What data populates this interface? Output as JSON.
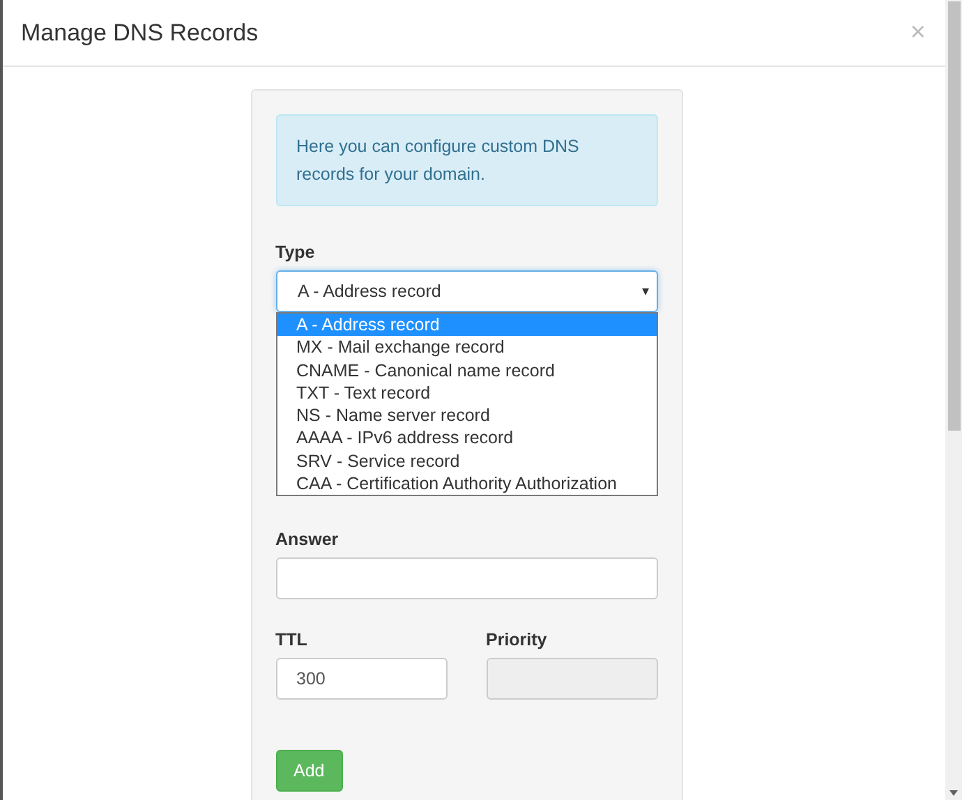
{
  "modal": {
    "title": "Manage DNS Records",
    "close": "×"
  },
  "info": "Here you can configure custom DNS records for your domain.",
  "type_field": {
    "label": "Type",
    "value": "A - Address record",
    "caret": "▾",
    "expanded": true,
    "options": [
      {
        "label": "A - Address record",
        "selected": true
      },
      {
        "label": "MX - Mail exchange record",
        "selected": false
      },
      {
        "label": "CNAME - Canonical name record",
        "selected": false
      },
      {
        "label": "TXT - Text record",
        "selected": false
      },
      {
        "label": "NS - Name server record",
        "selected": false
      },
      {
        "label": "AAAA - IPv6 address record",
        "selected": false
      },
      {
        "label": "SRV - Service record",
        "selected": false
      },
      {
        "label": "CAA - Certification Authority Authorization",
        "selected": false
      }
    ]
  },
  "answer_field": {
    "label": "Answer"
  },
  "ttl_field": {
    "label": "TTL",
    "value": "300"
  },
  "priority_field": {
    "label": "Priority",
    "disabled": true
  },
  "add_button": "Add"
}
